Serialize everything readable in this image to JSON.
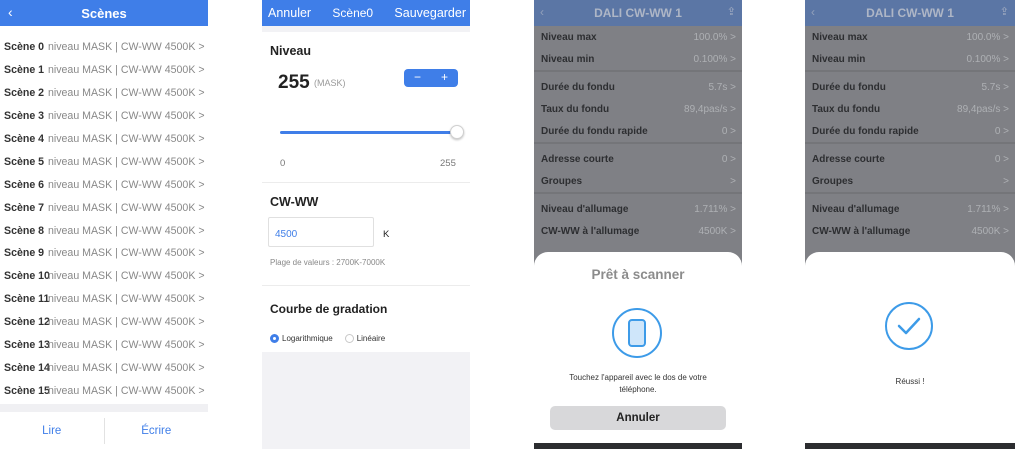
{
  "panel1": {
    "title": "Scènes",
    "back_icon": "‹",
    "scenes": [
      {
        "name": "Scène 0",
        "value": "niveau MASK | CW-WW 4500K >"
      },
      {
        "name": "Scène 1",
        "value": "niveau MASK | CW-WW 4500K >"
      },
      {
        "name": "Scène 2",
        "value": "niveau MASK | CW-WW 4500K >"
      },
      {
        "name": "Scène 3",
        "value": "niveau MASK | CW-WW 4500K >"
      },
      {
        "name": "Scène 4",
        "value": "niveau MASK | CW-WW 4500K >"
      },
      {
        "name": "Scène 5",
        "value": "niveau MASK | CW-WW 4500K >"
      },
      {
        "name": "Scène 6",
        "value": "niveau MASK | CW-WW 4500K >"
      },
      {
        "name": "Scène 7",
        "value": "niveau MASK | CW-WW 4500K >"
      },
      {
        "name": "Scène 8",
        "value": "niveau MASK | CW-WW 4500K >"
      },
      {
        "name": "Scène 9",
        "value": "niveau MASK | CW-WW 4500K >"
      },
      {
        "name": "Scène 10",
        "value": "niveau MASK | CW-WW 4500K >"
      },
      {
        "name": "Scène 11",
        "value": "niveau MASK | CW-WW 4500K >"
      },
      {
        "name": "Scène 12",
        "value": "niveau MASK | CW-WW 4500K >"
      },
      {
        "name": "Scène 13",
        "value": "niveau MASK | CW-WW 4500K >"
      },
      {
        "name": "Scène 14",
        "value": "niveau MASK | CW-WW 4500K >"
      },
      {
        "name": "Scène 15",
        "value": "niveau MASK | CW-WW 4500K >"
      }
    ],
    "read_label": "Lire",
    "write_label": "Écrire"
  },
  "panel2": {
    "cancel_label": "Annuler",
    "title": "Scène0",
    "save_label": "Sauvegarder",
    "level_title": "Niveau",
    "level_value": "255",
    "level_mask": "(MASK)",
    "minus": "−",
    "plus": "+",
    "slider_min": "0",
    "slider_max": "255",
    "slider_level": 1.0,
    "cw_title": "CW-WW",
    "cw_value": "4500",
    "cw_unit": "K",
    "cw_range": "Plage de valeurs : 2700K-7000K",
    "curve_title": "Courbe de gradation",
    "curve_options": [
      "Logarithmique",
      "Linéaire"
    ],
    "curve_selected": "Logarithmique"
  },
  "device": {
    "title": "DALI CW-WW 1",
    "back_icon": "‹",
    "share_icon": "⇪",
    "rows": [
      {
        "label": "Niveau max",
        "value": "100.0% >"
      },
      {
        "label": "Niveau min",
        "value": "0.100% >"
      },
      {
        "label": "Durée du fondu",
        "value": "5.7s >"
      },
      {
        "label": "Taux du fondu",
        "value": "89,4pas/s >"
      },
      {
        "label": "Durée du fondu rapide",
        "value": "0 >"
      },
      {
        "label": "Adresse courte",
        "value": "0 >"
      },
      {
        "label": "Groupes",
        "value": ">"
      },
      {
        "label": "Niveau d'allumage",
        "value": "1.711% >"
      },
      {
        "label": "CW-WW à l'allumage",
        "value": "4500K >"
      }
    ]
  },
  "panel3": {
    "sheet_title": "Prêt à scanner",
    "message_line1": "Touchez l'appareil avec le dos de votre",
    "message_line2": "téléphone.",
    "cancel_label": "Annuler"
  },
  "panel4": {
    "success_label": "Réussi !"
  },
  "colors": {
    "accent": "#3f7ee8",
    "scan_icon": "#3d9be8"
  }
}
